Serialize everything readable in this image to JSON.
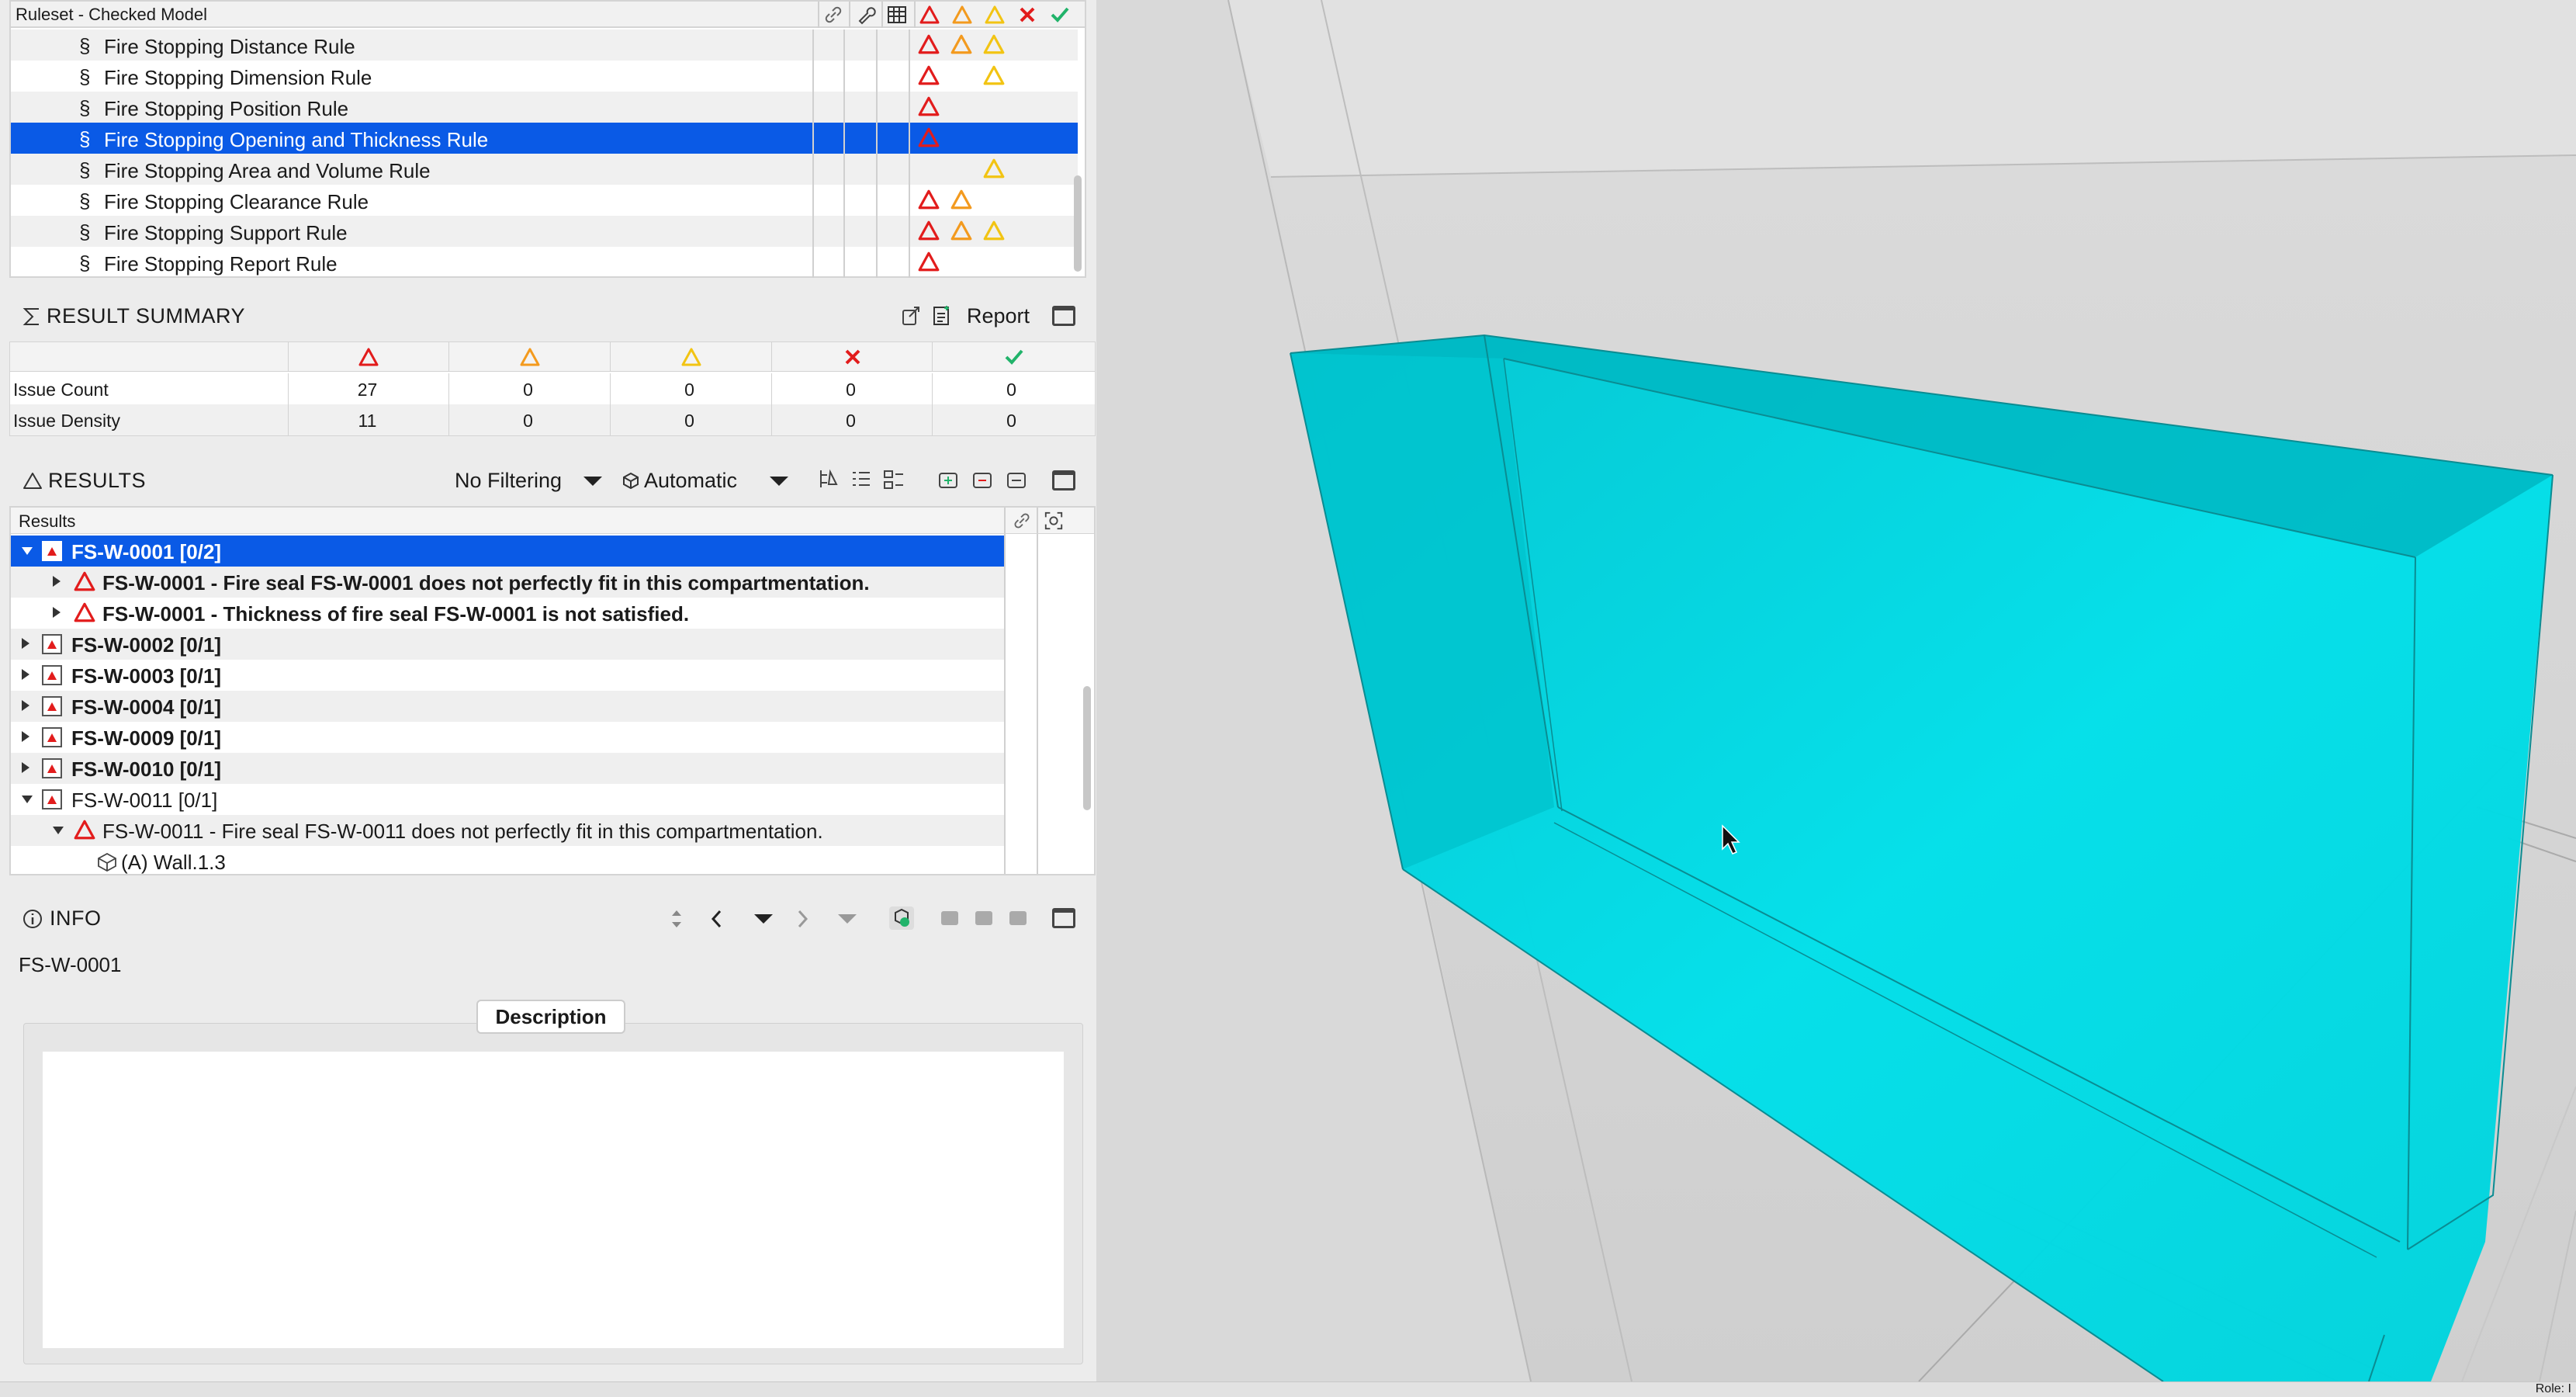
{
  "ruleset": {
    "title": "Ruleset - Checked Model",
    "rows": [
      {
        "name": "Fire Stopping Distance Rule",
        "marks": [
          "critical",
          "moderate",
          "low"
        ]
      },
      {
        "name": "Fire Stopping Dimension Rule",
        "marks": [
          "critical",
          "",
          "low"
        ]
      },
      {
        "name": "Fire Stopping Position Rule",
        "marks": [
          "critical"
        ]
      },
      {
        "name": "Fire Stopping Opening and Thickness Rule",
        "marks": [
          "critical"
        ],
        "selected": true
      },
      {
        "name": "Fire Stopping Area and Volume Rule",
        "marks": [
          "",
          "",
          "low"
        ]
      },
      {
        "name": "Fire Stopping Clearance Rule",
        "marks": [
          "critical",
          "moderate"
        ]
      },
      {
        "name": "Fire Stopping Support Rule",
        "marks": [
          "critical",
          "moderate",
          "low"
        ]
      },
      {
        "name": "Fire Stopping Report Rule",
        "marks": [
          "critical"
        ]
      }
    ],
    "section_symbol": "§"
  },
  "summary": {
    "title": "RESULT SUMMARY",
    "report_label": "Report",
    "rows": [
      {
        "label": "Issue Count",
        "values": [
          "27",
          "0",
          "0",
          "0",
          "0"
        ]
      },
      {
        "label": "Issue Density",
        "values": [
          "11",
          "0",
          "0",
          "0",
          "0"
        ]
      }
    ]
  },
  "results": {
    "title": "RESULTS",
    "filter": "No Filtering",
    "mode": "Automatic",
    "column_header": "Results",
    "items": [
      {
        "text": "FS-W-0001 [0/2]",
        "level": 0,
        "expanded": true,
        "selected": true,
        "bold": true,
        "icon": "building"
      },
      {
        "text": "FS-W-0001 - Fire seal FS-W-0001 does not perfectly fit in this compartmentation.",
        "level": 1,
        "expanded": false,
        "bold": true,
        "icon": "triangle"
      },
      {
        "text": "FS-W-0001 - Thickness of fire seal FS-W-0001 is not satisfied.",
        "level": 1,
        "expanded": false,
        "bold": true,
        "icon": "triangle"
      },
      {
        "text": "FS-W-0002 [0/1]",
        "level": 0,
        "expanded": false,
        "bold": true,
        "icon": "building"
      },
      {
        "text": "FS-W-0003 [0/1]",
        "level": 0,
        "expanded": false,
        "bold": true,
        "icon": "building"
      },
      {
        "text": "FS-W-0004 [0/1]",
        "level": 0,
        "expanded": false,
        "bold": true,
        "icon": "building"
      },
      {
        "text": "FS-W-0009 [0/1]",
        "level": 0,
        "expanded": false,
        "bold": true,
        "icon": "building"
      },
      {
        "text": "FS-W-0010 [0/1]",
        "level": 0,
        "expanded": false,
        "bold": true,
        "icon": "building"
      },
      {
        "text": "FS-W-0011 [0/1]",
        "level": 0,
        "expanded": true,
        "bold": false,
        "icon": "building"
      },
      {
        "text": "FS-W-0011 - Fire seal FS-W-0011 does not perfectly fit in this compartmentation.",
        "level": 1,
        "expanded": true,
        "bold": false,
        "icon": "triangle"
      },
      {
        "text": "(A) Wall.1.3",
        "level": 2,
        "bold": false,
        "icon": "wall"
      }
    ]
  },
  "info": {
    "title": "INFO",
    "value": "FS-W-0001",
    "tab": "Description"
  },
  "statusbar": {
    "text": "Role: I"
  },
  "colors": {
    "selection": "#0a5ae6",
    "critical": "#e21c1c",
    "moderate": "#f39a1e",
    "low": "#f2c413",
    "success": "#21b36a",
    "fire_seal": "#00d2dc"
  }
}
